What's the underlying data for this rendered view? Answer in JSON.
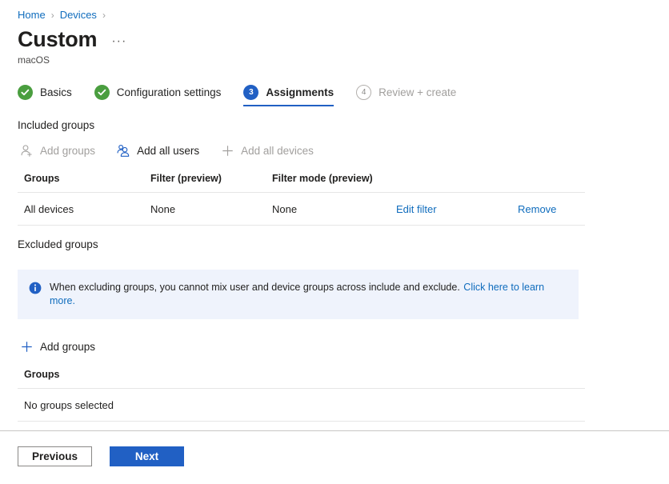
{
  "breadcrumb": {
    "items": [
      {
        "label": "Home",
        "icon": ""
      },
      {
        "label": "Devices",
        "icon": ""
      }
    ],
    "separator": "›"
  },
  "header": {
    "title": "Custom",
    "subtitle": "macOS",
    "more_actions": "···",
    "more_actions_name": "more-actions-icon"
  },
  "wizard": {
    "steps": [
      {
        "badge": "✓",
        "label": "Basics",
        "state": "done"
      },
      {
        "badge": "✓",
        "label": "Configuration settings",
        "state": "done"
      },
      {
        "badge": "3",
        "label": "Assignments",
        "state": "active"
      },
      {
        "badge": "4",
        "label": "Review + create",
        "state": "todo"
      }
    ]
  },
  "included": {
    "heading": "Included groups",
    "commands": [
      {
        "label": "Add groups",
        "icon": "add-user-icon",
        "enabled": false
      },
      {
        "label": "Add all users",
        "icon": "all-users-icon",
        "enabled": true
      },
      {
        "label": "Add all devices",
        "icon": "plus-icon",
        "enabled": false
      }
    ],
    "table": {
      "columns": [
        "Groups",
        "Filter (preview)",
        "Filter mode (preview)",
        "",
        ""
      ],
      "rows": [
        {
          "group": "All devices",
          "filter": "None",
          "filter_mode": "None",
          "edit_link": "Edit filter",
          "remove_link": "Remove"
        }
      ]
    }
  },
  "excluded": {
    "heading": "Excluded groups",
    "info": {
      "icon": "info-icon",
      "text": "When excluding groups, you cannot mix user and device groups across include and exclude.",
      "link": "Click here to learn more."
    },
    "command": {
      "label": "Add groups",
      "icon": "plus-icon",
      "enabled": true
    },
    "table": {
      "columns": [
        "Groups"
      ],
      "rows": [
        {
          "group": "No groups selected"
        }
      ]
    }
  },
  "footer": {
    "previous_label": "Previous",
    "next_label": "Next"
  },
  "colors": {
    "accent": "#2160c4",
    "link": "#0f6cbd",
    "success": "#4a9e3f",
    "info_bg": "#eff3fc",
    "disabled_text": "#a19f9d"
  }
}
